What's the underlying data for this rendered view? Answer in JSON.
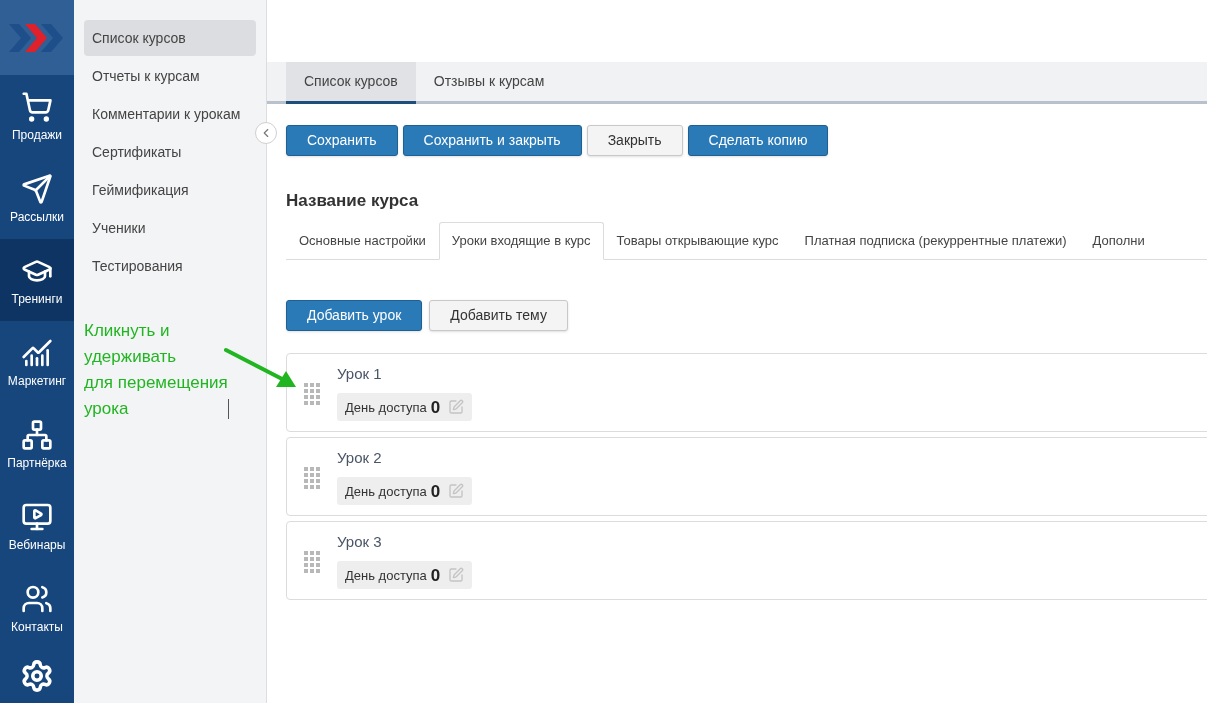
{
  "nav": [
    {
      "label": "Продажи",
      "selected": false
    },
    {
      "label": "Рассылки",
      "selected": false
    },
    {
      "label": "Тренинги",
      "selected": true
    },
    {
      "label": "Маркетинг",
      "selected": false
    },
    {
      "label": "Партнёрка",
      "selected": false
    },
    {
      "label": "Вебинары",
      "selected": false
    },
    {
      "label": "Контакты",
      "selected": false
    }
  ],
  "submenu": [
    {
      "label": "Список курсов",
      "selected": true
    },
    {
      "label": "Отчеты к курсам",
      "selected": false
    },
    {
      "label": "Комментарии к урокам",
      "selected": false
    },
    {
      "label": "Сертификаты",
      "selected": false
    },
    {
      "label": "Геймификация",
      "selected": false
    },
    {
      "label": "Ученики",
      "selected": false
    },
    {
      "label": "Тестирования",
      "selected": false
    }
  ],
  "annotation": {
    "lines": [
      "Кликнуть и",
      "удерживать",
      "для перемещения",
      "урока"
    ]
  },
  "tabs": [
    {
      "label": "Список курсов",
      "selected": true
    },
    {
      "label": "Отзывы к курсам",
      "selected": false
    }
  ],
  "buttons": [
    {
      "label": "Сохранить",
      "kind": "primary"
    },
    {
      "label": "Сохранить и закрыть",
      "kind": "primary"
    },
    {
      "label": "Закрыть",
      "kind": "default"
    },
    {
      "label": "Сделать копию",
      "kind": "primary"
    }
  ],
  "course_title": "Название курса",
  "subtabs": [
    {
      "label": "Основные настройки",
      "selected": false
    },
    {
      "label": "Уроки входящие в курс",
      "selected": true
    },
    {
      "label": "Товары открывающие курс",
      "selected": false
    },
    {
      "label": "Платная подписка (рекуррентные платежи)",
      "selected": false
    },
    {
      "label": "Дополни",
      "selected": false
    }
  ],
  "lesson_buttons": [
    {
      "label": "Добавить урок",
      "kind": "primary"
    },
    {
      "label": "Добавить тему",
      "kind": "default"
    }
  ],
  "lessons": [
    {
      "title": "Урок 1",
      "access_label": "День доступа",
      "access_value": "0"
    },
    {
      "title": "Урок 2",
      "access_label": "День доступа",
      "access_value": "0"
    },
    {
      "title": "Урок 3",
      "access_label": "День доступа",
      "access_value": "0"
    }
  ]
}
